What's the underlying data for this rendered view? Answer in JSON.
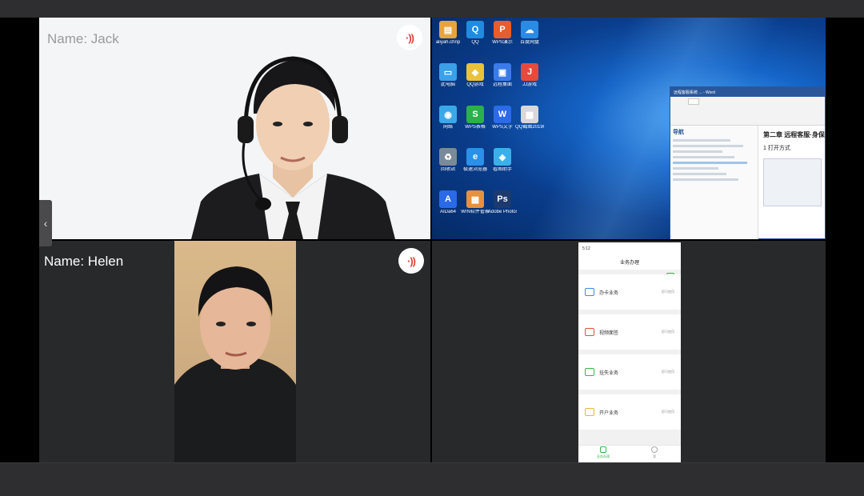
{
  "tiles": {
    "jack": {
      "name": "Name: Jack"
    },
    "screen": {
      "desktop_icons": [
        {
          "label": "aliyah.chnp",
          "color": "#e8a33c",
          "glyph": "▤"
        },
        {
          "label": "QQ",
          "color": "#1f8ce0",
          "glyph": "Q"
        },
        {
          "label": "WPS演示",
          "color": "#e85d2b",
          "glyph": "P"
        },
        {
          "label": "百度网盘",
          "color": "#2a8be4",
          "glyph": "☁"
        },
        {
          "label": "此电脑",
          "color": "#3aa0e8",
          "glyph": "▭"
        },
        {
          "label": "QQ游戏",
          "color": "#e8c23a",
          "glyph": "◆"
        },
        {
          "label": "远程桌面",
          "color": "#3a7be8",
          "glyph": "▣"
        },
        {
          "label": "JJ游戏",
          "color": "#e84a3a",
          "glyph": "J"
        },
        {
          "label": "网络",
          "color": "#3aa8e8",
          "glyph": "◉"
        },
        {
          "label": "WPS表格",
          "color": "#2bb04a",
          "glyph": "S"
        },
        {
          "label": "WPS文字",
          "color": "#2b6be8",
          "glyph": "W"
        },
        {
          "label": "QQ截图20190617...",
          "color": "#d8d8d8",
          "glyph": "▦"
        },
        {
          "label": "回收站",
          "color": "#7a8a9a",
          "glyph": "♻"
        },
        {
          "label": "极速浏览器",
          "color": "#2a90e8",
          "glyph": "e"
        },
        {
          "label": "看图助手",
          "color": "#3ab0e8",
          "glyph": "◈"
        },
        {
          "label": "AIDa64",
          "color": "#2a6ae8",
          "glyph": "A"
        },
        {
          "label": "WIN软件管家",
          "color": "#e8903a",
          "glyph": "▦"
        },
        {
          "label": "Adobe Photosh...",
          "color": "#1c3a6e",
          "glyph": "Ps"
        }
      ],
      "word_window": {
        "title": "远程客服系统 ... - Word",
        "nav_title": "导航",
        "heading": "第二章 远程客服·身保",
        "subheading": "1 打开方式"
      }
    },
    "helen": {
      "name": "Name: Helen"
    },
    "phone": {
      "time": "5:12",
      "title": "业务办理",
      "cards": [
        {
          "label": "办卡业务",
          "side": "即可使用",
          "color": "#3a8be8"
        },
        {
          "label": "视频面签",
          "side": "即可使用",
          "color": "#e8503a"
        },
        {
          "label": "挂失业务",
          "side": "即可使用",
          "color": "#39b54a"
        },
        {
          "label": "开户业务",
          "side": "即可使用",
          "color": "#e8b83a"
        }
      ],
      "tabbar": [
        {
          "label": "业务办理"
        },
        {
          "label": "我"
        }
      ]
    }
  },
  "controls": {
    "side_tab_glyph": "‹",
    "audio_glyph": "·))"
  }
}
